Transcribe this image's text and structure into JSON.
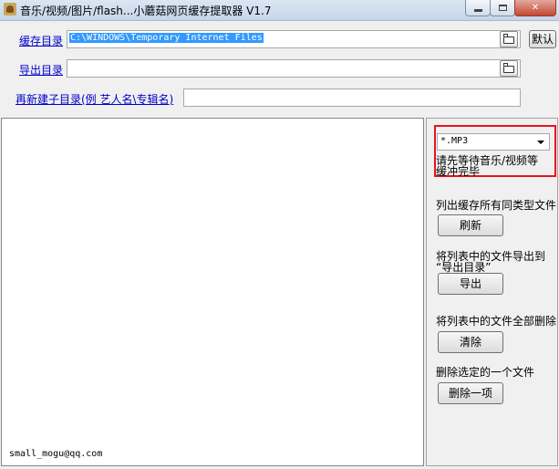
{
  "window": {
    "title": "音乐/视频/图片/flash...小蘑菇网页缓存提取器 V1.7",
    "minimize": "minimize",
    "maximize": "maximize",
    "close_label": "✕"
  },
  "form": {
    "cache_dir_label": "缓存目录",
    "cache_dir_value": "C:\\WINDOWS\\Temporary Internet Files",
    "default_button": "默认",
    "export_dir_label": "导出目录",
    "export_dir_value": "",
    "subdir_label": "再新建子目录(例 艺人名\\专辑名)",
    "subdir_value": ""
  },
  "icons": {
    "browse": "folder-open-icon",
    "dropdown": "chevron-down-icon"
  },
  "status": {
    "email": "small_mogu@qq.com"
  },
  "panel": {
    "file_type": "*.MP3",
    "wait_note_line1": "请先等待音乐/视频等",
    "wait_note_line2": "缓冲完毕",
    "list_note": "列出缓存所有同类型文件",
    "refresh_button": "刷新",
    "export_note_line1": "将列表中的文件导出到",
    "export_note_line2": "“导出目录”",
    "export_button": "导出",
    "clear_note": "将列表中的文件全部删除",
    "clear_button": "清除",
    "delete_note": "删除选定的一个文件",
    "delete_button": "删除一项"
  },
  "colors": {
    "link": "#0000cc",
    "highlight_border": "#e8121c",
    "selection": "#3399ff"
  }
}
